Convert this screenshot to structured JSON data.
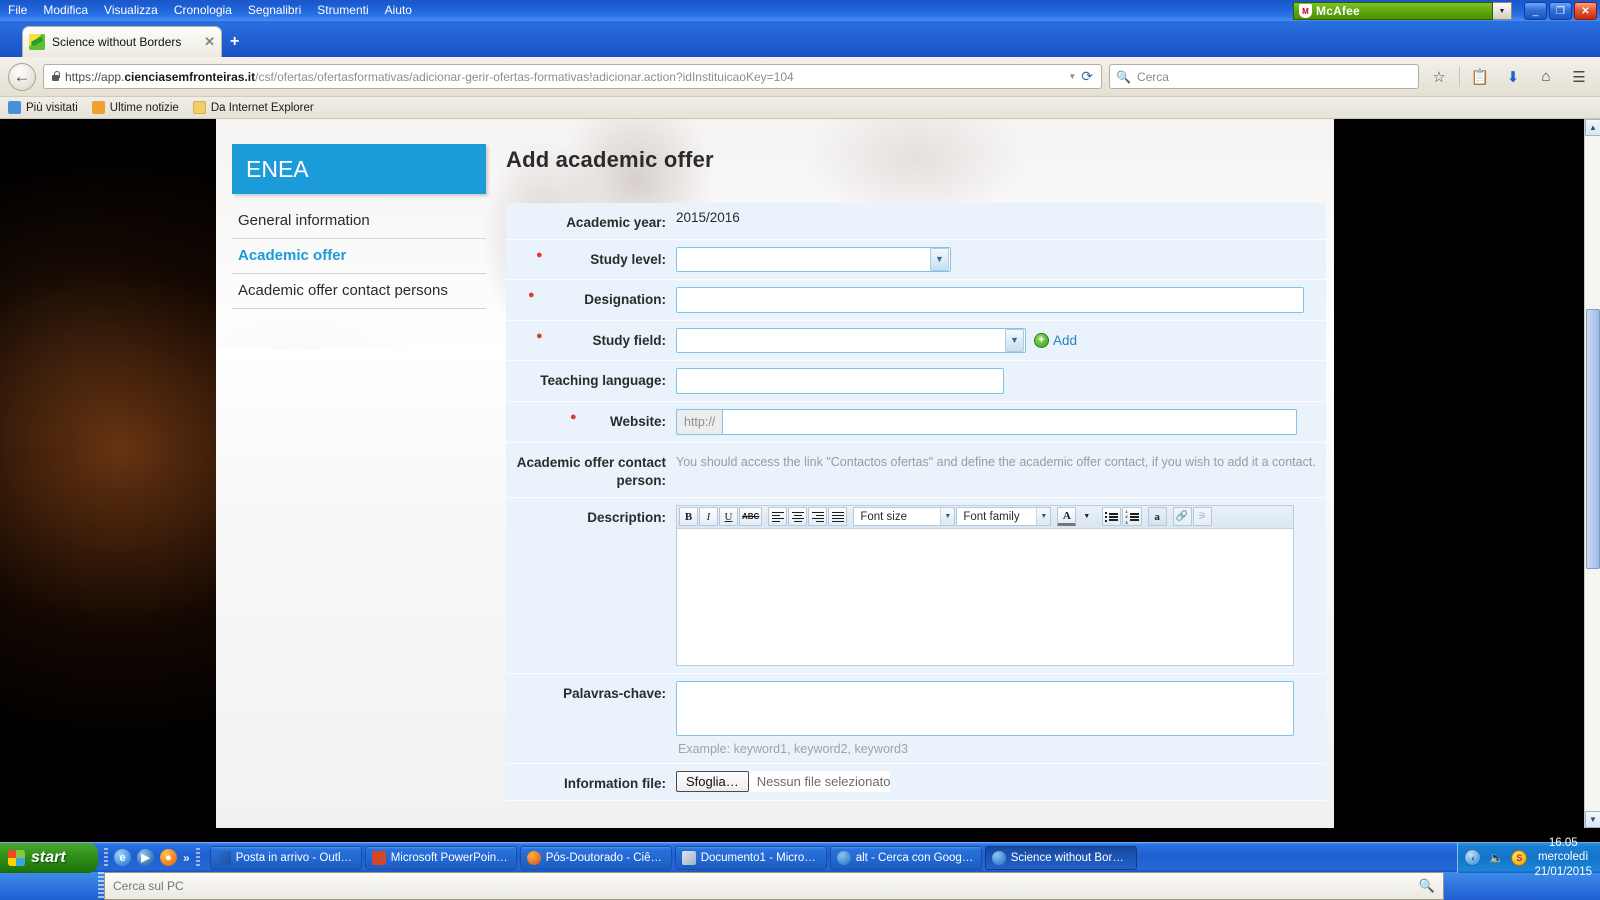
{
  "browser": {
    "menu": [
      {
        "label": "File",
        "accel": "F"
      },
      {
        "label": "Modifica",
        "accel": "M"
      },
      {
        "label": "Visualizza",
        "accel": "V"
      },
      {
        "label": "Cronologia",
        "accel": "C"
      },
      {
        "label": "Segnalibri",
        "accel": "g"
      },
      {
        "label": "Strumenti",
        "accel": "S"
      },
      {
        "label": "Aiuto",
        "accel": "A"
      }
    ],
    "mcafee": {
      "label": "McAfee",
      "shield_icon": "shield-icon",
      "dropdown_icon": "chevron-down-icon"
    },
    "window_controls": {
      "minimize": "_",
      "restore": "❐",
      "close": "✕"
    },
    "tab": {
      "title": "Science without Borders",
      "close_label": "✕",
      "favicon": "site-favicon"
    },
    "new_tab_label": "+",
    "back_arrow": "←",
    "url": {
      "scheme": "https://app.",
      "domain": "cienciasemfronteiras.it",
      "path": "/csf/ofertas/ofertasformativas/adicionar-gerir-ofertas-formativas!adicionar.action?idInstituicaoKey=104",
      "full": "https://app.cienciasemfronteiras.it/csf/ofertas/ofertasformativas/adicionar-gerir-ofertas-formativas!adicionar.action?idInstituicaoKey=104"
    },
    "url_dropdown_icon": "▼",
    "reload_icon": "⟳",
    "search": {
      "placeholder": "Cerca",
      "icon": "search-icon"
    },
    "nav_icons": [
      {
        "name": "bookmark-star-icon",
        "glyph": "☆"
      },
      {
        "name": "reading-list-icon",
        "glyph": "Ὄb"
      },
      {
        "name": "downloads-icon",
        "glyph": "⬇"
      },
      {
        "name": "home-icon",
        "glyph": "⌂"
      },
      {
        "name": "menu-hamburger-icon",
        "glyph": "☰"
      }
    ],
    "bookmarks": [
      {
        "label": "Più visitati",
        "icon": "most-visited-icon"
      },
      {
        "label": "Ultime notizie",
        "icon": "rss-icon"
      },
      {
        "label": "Da Internet Explorer",
        "icon": "folder-icon"
      }
    ]
  },
  "page": {
    "sidebar": {
      "brand": "ENEA",
      "items": [
        {
          "label": "General information",
          "active": false
        },
        {
          "label": "Academic offer",
          "active": true
        },
        {
          "label": "Academic offer contact persons",
          "active": false
        }
      ]
    },
    "title": "Add academic offer",
    "fields": {
      "academic_year": {
        "label": "Academic year:",
        "value": "2015/2016",
        "required": false
      },
      "study_level": {
        "label": "Study level:",
        "value": "",
        "required": true
      },
      "designation": {
        "label": "Designation:",
        "value": "",
        "required": true
      },
      "study_field": {
        "label": "Study field:",
        "value": "",
        "required": true,
        "add_label": "Add",
        "add_icon": "plus-circle-icon"
      },
      "teaching_language": {
        "label": "Teaching language:",
        "value": "",
        "required": false
      },
      "website": {
        "label": "Website:",
        "prefix": "http://",
        "value": "",
        "required": true
      },
      "contact_person": {
        "label": "Academic offer contact person:",
        "help": "You should access the link \"Contactos ofertas\" and define the academic offer contact, if you wish to add it a contact.",
        "required": false
      },
      "description": {
        "label": "Description:",
        "value": "",
        "required": false
      },
      "keywords": {
        "label": "Palavras-chave:",
        "value": "",
        "hint": "Example: keyword1, keyword2, keyword3",
        "required": false
      },
      "information_file": {
        "label": "Information file:",
        "button": "Sfoglia…",
        "status": "Nessun file selezionato",
        "required": false
      }
    },
    "editor_toolbar": {
      "bold": "B",
      "italic": "I",
      "underline": "U",
      "strikethrough": "ABC",
      "align_left": "align-left-icon",
      "align_center": "align-center-icon",
      "align_right": "align-right-icon",
      "align_justify": "align-justify-icon",
      "font_size": "Font size",
      "font_family": "Font family",
      "text_color": "A",
      "bullet_list": "bullet-list-icon",
      "numbered_list": "numbered-list-icon",
      "highlight": "a",
      "link": "link-icon",
      "unlink": "unlink-icon"
    },
    "scrollbar": {
      "up_icon": "▲",
      "down_icon": "▼"
    }
  },
  "taskbar": {
    "start_label": "start",
    "quicklaunch": [
      {
        "name": "internet-explorer-icon",
        "glyph": "e"
      },
      {
        "name": "windows-media-player-icon",
        "glyph": "▶"
      },
      {
        "name": "firefox-icon",
        "glyph": "●"
      }
    ],
    "quicklaunch_more": "»",
    "tasks": [
      {
        "label": "Posta in arrivo - Outl…",
        "icon": "outlook-icon",
        "active": false
      },
      {
        "label": "Microsoft PowerPoint …",
        "icon": "powerpoint-icon",
        "active": false
      },
      {
        "label": "Pós-Doutorado - Ciên…",
        "icon": "firefox-icon",
        "active": false
      },
      {
        "label": "Documento1 - Micros…",
        "icon": "word-icon",
        "active": false
      },
      {
        "label": "alt - Cerca con Googl…",
        "icon": "firefox-icon",
        "active": false
      },
      {
        "label": "Science without Bord…",
        "icon": "firefox-icon",
        "active": true
      }
    ],
    "tray": {
      "show_hidden_icon": "‹",
      "mcafee_icon": "S",
      "volume_icon": "🔊",
      "time": "16.05",
      "day": "mercoledì",
      "date": "21/01/2015"
    },
    "desktop_search": {
      "placeholder": "Cerca sul PC",
      "icon": "search-icon"
    }
  }
}
